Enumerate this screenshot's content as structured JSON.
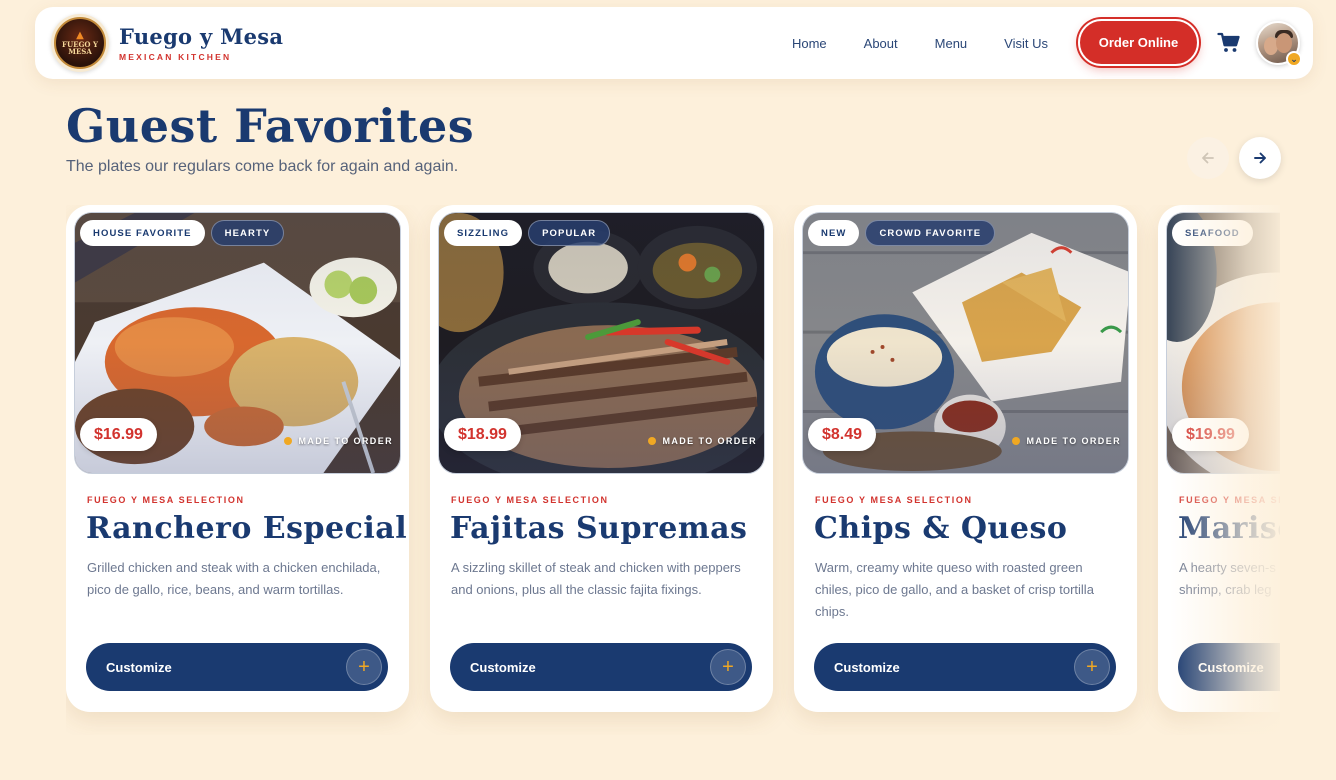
{
  "brand": {
    "logo_text": "FUEGO Y MESA",
    "name": "Fuego y Mesa",
    "tagline": "MEXICAN KITCHEN"
  },
  "nav": {
    "links": [
      "Home",
      "About",
      "Menu",
      "Visit Us"
    ],
    "cta": "Order Online",
    "cart_icon": "cart-icon",
    "avatar_badge_icon": "chevron-down-icon"
  },
  "section": {
    "title": "Guest Favorites",
    "subtitle": "The plates our regulars come back for again and again.",
    "prev_icon": "arrow-left-icon",
    "next_icon": "arrow-right-icon"
  },
  "colors": {
    "page_bg": "#fdf0db",
    "navy": "#1a3a70",
    "red": "#d42e28",
    "gold": "#f0a823"
  },
  "cards": [
    {
      "tags": [
        "HOUSE FAVORITE",
        "HEARTY"
      ],
      "price": "$16.99",
      "status": "MADE TO ORDER",
      "eyebrow": "FUEGO Y MESA SELECTION",
      "name": "Ranchero Especial",
      "description": "Grilled chicken and steak with a chicken enchilada, pico de gallo, rice, beans, and warm tortillas.",
      "button": "Customize"
    },
    {
      "tags": [
        "SIZZLING",
        "POPULAR"
      ],
      "price": "$18.99",
      "status": "MADE TO ORDER",
      "eyebrow": "FUEGO Y MESA SELECTION",
      "name": "Fajitas Supremas",
      "description": "A sizzling skillet of steak and chicken with peppers and onions, plus all the classic fajita fixings.",
      "button": "Customize"
    },
    {
      "tags": [
        "NEW",
        "CROWD FAVORITE"
      ],
      "price": "$8.49",
      "status": "MADE TO ORDER",
      "eyebrow": "FUEGO Y MESA SELECTION",
      "name": "Chips & Queso",
      "description": "Warm, creamy white queso with roasted green chiles, pico de gallo, and a basket of crisp tortilla chips.",
      "button": "Customize"
    },
    {
      "tags": [
        "SEAFOOD"
      ],
      "price": "$19.99",
      "status": "",
      "eyebrow": "FUEGO Y MESA SE",
      "name": "Mariso",
      "description": "A hearty seven-s shrimp, crab leg",
      "button": "Customize"
    }
  ]
}
